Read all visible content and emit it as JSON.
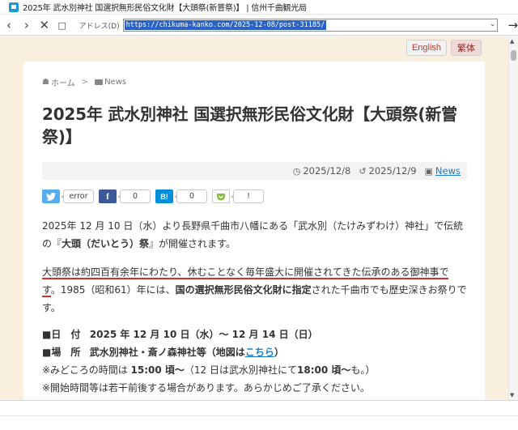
{
  "window": {
    "title": "2025年 武水別神社 国選択無形民俗文化財【大頭祭(新嘗祭)】 | 信州千曲観光局"
  },
  "addressbar": {
    "label": "アドレス(D)",
    "url": "https://chikuma-kanko.com/2025-12-08/post-31185/"
  },
  "lang": {
    "english": "English",
    "traditional": "繁体"
  },
  "breadcrumb": {
    "home": "ホーム",
    "separator": ">",
    "category": "News"
  },
  "article": {
    "title": "2025年 武水別神社 国選択無形民俗文化財【大頭祭(新嘗祭)】",
    "published": "2025/12/8",
    "updated": "2025/12/9",
    "category_link": "News"
  },
  "share": {
    "twitter_count": "error",
    "facebook_count": "0",
    "hatena_count": "0",
    "pocket_count": "!",
    "facebook_logo": "f",
    "hatena_logo": "B!",
    "colors": {
      "twitter": "#55acee",
      "facebook": "#3b5998",
      "hatena": "#008fde",
      "pocket": "#8bbd3c"
    }
  },
  "content": {
    "p1_a": "2025年 12 月 10 日（水）より長野県千曲市八幡にある「武水別（たけみずわけ）神社」で伝統の『",
    "p1_b": "大頭（だいとう）祭",
    "p1_c": "』が開催されます。",
    "p2_a": "大頭祭は約四百有余年にわたり、休むことなく毎年盛大に開催されてきた伝承のある御神事です",
    "p2_b": "。1985（昭和61）年には、",
    "p2_c": "国の選択無形民俗文化財に指定",
    "p2_d": "された千曲市でも歴史深きお祭りです。",
    "date_label": "■日　付",
    "date_value": "2025 年 12 月 10 日（水）～ 12 月 14 日（日）",
    "place_label": "■場　所",
    "place_value": "武水別神社・斎ノ森神社等（地図は",
    "place_link": "こちら",
    "place_close": "）",
    "note1_a": "※みどころの時間は",
    "note1_b": "15:00 頃～",
    "note1_c": "（12 日は武水別神社にて",
    "note1_d": "18:00 頃～",
    "note1_e": "も。）",
    "note2": "※開始時間等は若干前後する場合があります。あらかじめご了承ください。"
  }
}
